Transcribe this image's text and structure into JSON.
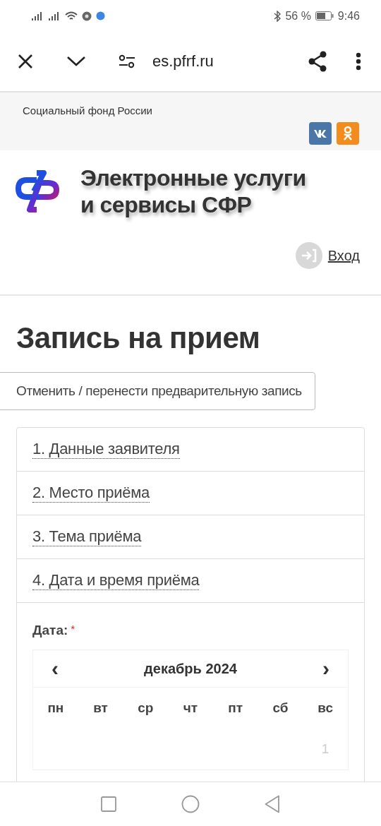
{
  "status_bar": {
    "battery": "56 %",
    "time": "9:46"
  },
  "browser": {
    "url": "es.pfrf.ru"
  },
  "site_header": {
    "org": "Социальный фонд России",
    "title_lines": [
      "Электронные услуги",
      "и сервисы СФР"
    ],
    "login": "Вход"
  },
  "page": {
    "title": "Запись на прием",
    "cancel_button": "Отменить / перенести предварительную запись"
  },
  "steps": [
    {
      "label": "1. Данные заявителя"
    },
    {
      "label": "2. Место приёма"
    },
    {
      "label": "3. Тема приёма"
    },
    {
      "label": "4. Дата и время приёма"
    }
  ],
  "date_field": {
    "label": "Дата:",
    "required_mark": "*"
  },
  "calendar": {
    "prev": "‹",
    "month": "декабрь 2024",
    "next": "›",
    "weekdays": [
      "пн",
      "вт",
      "ср",
      "чт",
      "пт",
      "сб",
      "вс"
    ],
    "days": [
      {
        "label": "1",
        "disabled": true
      }
    ]
  }
}
